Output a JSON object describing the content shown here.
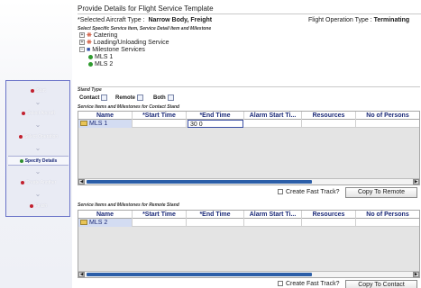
{
  "page": {
    "title": "Provide Details for Flight Service Template",
    "aircraft_label": "*Selected Aircraft Type :",
    "aircraft_value": "Narrow Body, Freight",
    "flight_op_label": "Flight Operation Type :",
    "flight_op_value": "Terminating"
  },
  "wizard": {
    "steps": [
      {
        "label": "Start",
        "active": false
      },
      {
        "label": "Select Aircraft",
        "active": false
      },
      {
        "label": "Select Operation",
        "active": false
      },
      {
        "label": "Specify Details",
        "active": true
      },
      {
        "label": "Create Another",
        "active": false
      },
      {
        "label": "Finish",
        "active": false
      }
    ]
  },
  "services": {
    "caption": "Select Specific Service Item, Service Detail Item and Milestone",
    "items": [
      "Catering",
      "Loading/Unloading Service",
      "Milestone Services"
    ],
    "milestones": [
      "MLS 1",
      "MLS 2"
    ]
  },
  "stand": {
    "caption": "Stand Type",
    "options": [
      "Contact",
      "Remote",
      "Both"
    ]
  },
  "contact_grid": {
    "caption": "Service Items and Milestones for Contact Stand",
    "columns": [
      "Name",
      "*Start Time",
      "*End Time",
      "Alarm Start Ti...",
      "Resources",
      "No of Persons"
    ],
    "rows": [
      {
        "name": "MLS 1",
        "start": "",
        "end": "30 0",
        "alarm": "",
        "resources": "",
        "persons": ""
      }
    ],
    "fast_track_label": "Create Fast Track?",
    "copy_button": "Copy To Remote"
  },
  "remote_grid": {
    "caption": "Service Items and Milestones for Remote Stand",
    "columns": [
      "Name",
      "*Start Time",
      "*End Time",
      "Alarm Start Ti...",
      "Resources",
      "No of Persons"
    ],
    "rows": [
      {
        "name": "MLS 2",
        "start": "",
        "end": "",
        "alarm": "",
        "resources": "",
        "persons": ""
      }
    ],
    "fast_track_label": "Create Fast Track?",
    "copy_button": "Copy To Contact"
  }
}
